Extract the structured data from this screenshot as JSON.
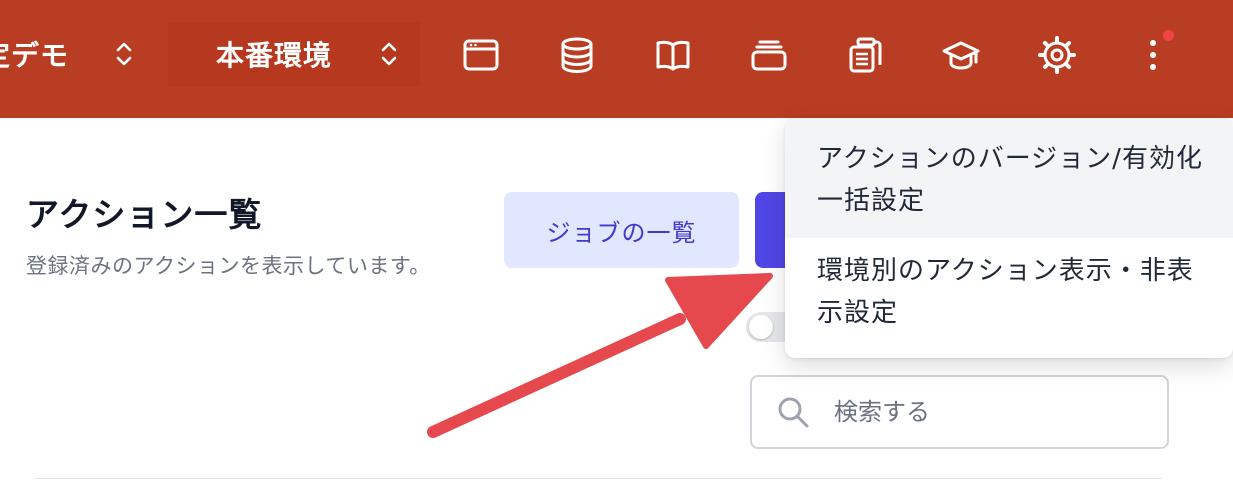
{
  "header": {
    "project_selector": {
      "label": "定デモ"
    },
    "environment_selector": {
      "label": "本番環境"
    },
    "nav_icons": [
      "browser-window-icon",
      "database-icon",
      "book-icon",
      "archive-box-icon",
      "clipboard-list-icon",
      "graduation-cap-icon",
      "gear-icon",
      "more-vertical-icon"
    ],
    "accent": "#b93d22",
    "notification_color": "#ef4444"
  },
  "main": {
    "title": "アクション一覧",
    "description": "登録済みのアクションを表示しています。",
    "jobs_button_label": "ジョブの一覧",
    "primary_color": "#4f46e5",
    "search": {
      "placeholder": "検索する"
    }
  },
  "dropdown": {
    "items": [
      {
        "label": "アクションのバージョン/有効化一括設定"
      },
      {
        "label": "環境別のアクション表示・非表示設定"
      }
    ]
  },
  "annotation": {
    "color": "#e5484d"
  }
}
